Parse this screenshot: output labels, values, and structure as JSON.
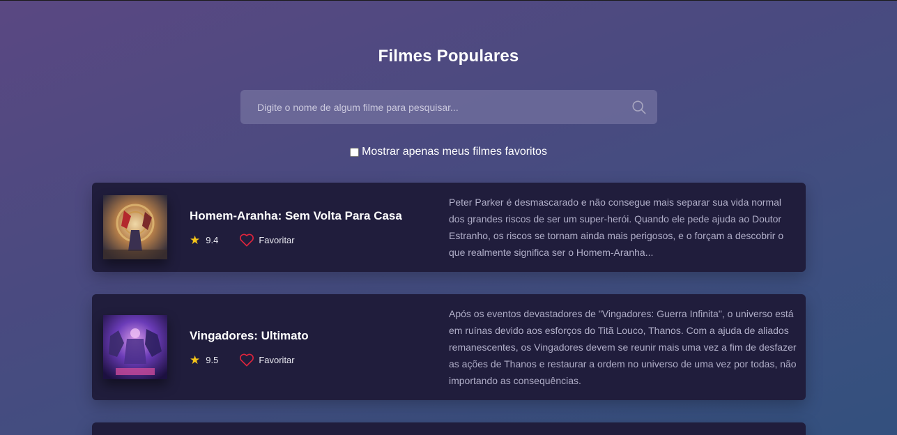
{
  "header": {
    "title": "Filmes Populares"
  },
  "search": {
    "placeholder": "Digite o nome de algum filme para pesquisar...",
    "value": ""
  },
  "filter": {
    "label": "Mostrar apenas meus filmes favoritos",
    "checked": false
  },
  "colors": {
    "card_bg": "#201d3c",
    "star": "#f5c518",
    "heart": "#e0243c"
  },
  "movies": [
    {
      "title": "Homem-Aranha: Sem Volta Para Casa",
      "rating": "9.4",
      "favorite_label": "Favoritar",
      "overview": "Peter Parker é desmascarado e não consegue mais separar sua vida normal dos grandes riscos de ser um super-herói. Quando ele pede ajuda ao Doutor Estranho, os riscos se tornam ainda mais perigosos, e o forçam a descobrir o que realmente significa ser o Homem-Aranha..."
    },
    {
      "title": "Vingadores: Ultimato",
      "rating": "9.5",
      "favorite_label": "Favoritar",
      "overview": "Após os eventos devastadores de \"Vingadores: Guerra Infinita\", o universo está em ruínas devido aos esforços do Titã Louco, Thanos. Com a ajuda de aliados remanescentes, os Vingadores devem se reunir mais uma vez a fim de desfazer as ações de Thanos e restaurar a ordem no universo de uma vez por todas, não importando as consequências."
    }
  ]
}
